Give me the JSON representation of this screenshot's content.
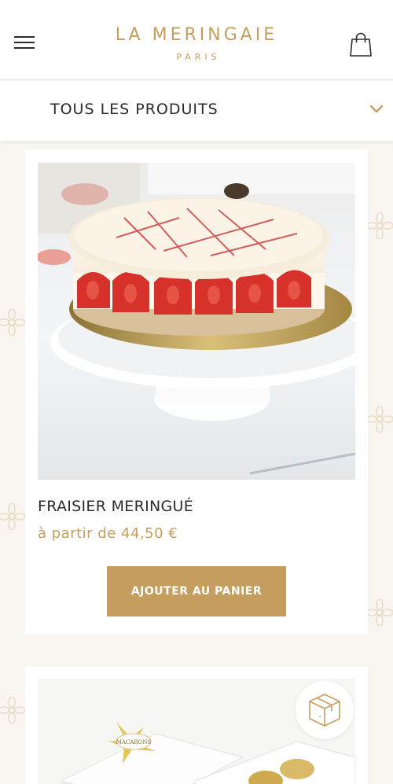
{
  "header": {
    "brand_name": "LA MERINGAIE",
    "brand_city": "PARIS",
    "menu_icon": "hamburger-menu-icon",
    "cart_icon": "shopping-bag-icon"
  },
  "category_bar": {
    "label": "TOUS LES PRODUITS",
    "icon": "chevron-down-icon"
  },
  "products": [
    {
      "name": "FRAISIER MERINGUÉ",
      "price": "à partir de 44,50 €",
      "button_label": "AJOUTER AU PANIER",
      "image": "strawberry-meringue-cake-photo"
    },
    {
      "image": "macaron-box-photo",
      "box_label": "MACARONS",
      "badge_icon": "gift-box-icon"
    }
  ],
  "colors": {
    "accent": "#c59d5f",
    "text": "#2b2b2b",
    "background": "#f8f5f0",
    "card": "#ffffff"
  }
}
